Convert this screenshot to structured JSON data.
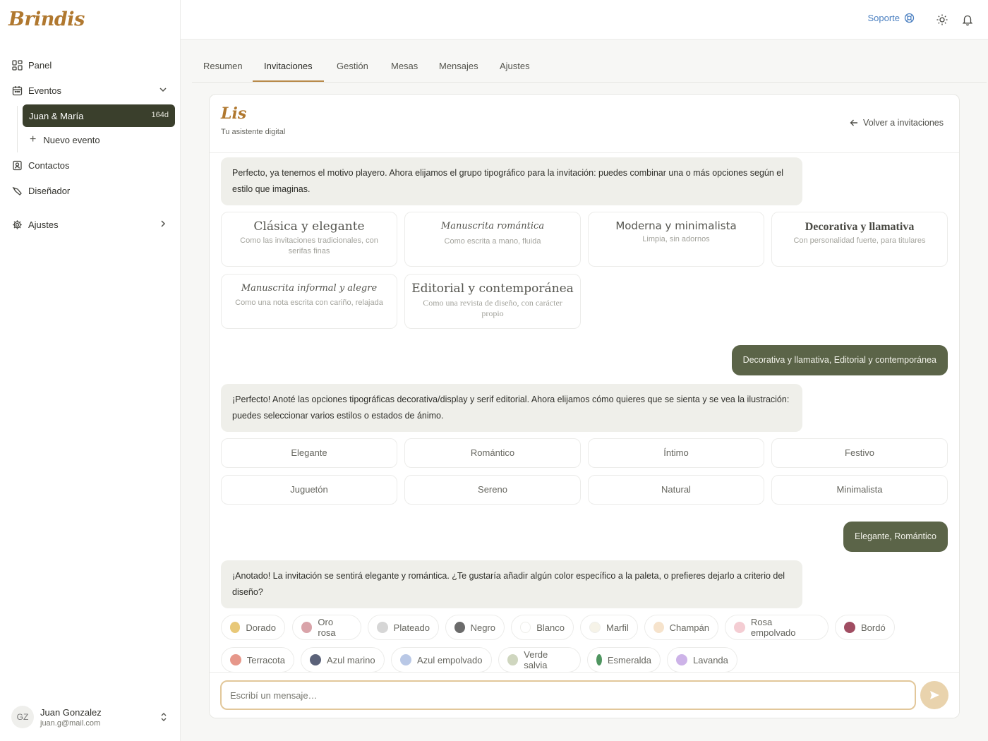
{
  "brand": "Brindis",
  "sidebar": {
    "panel": "Panel",
    "eventos": "Eventos",
    "active_event": {
      "label": "Juan & María",
      "badge": "164d"
    },
    "new_event": "Nuevo evento",
    "contactos": "Contactos",
    "disenador": "Diseñador",
    "ajustes": "Ajustes"
  },
  "user": {
    "initials": "GZ",
    "name": "Juan Gonzalez",
    "email": "juan.g@mail.com"
  },
  "header": {
    "support": "Soporte"
  },
  "tabs": [
    "Resumen",
    "Invitaciones",
    "Gestión",
    "Mesas",
    "Mensajes",
    "Ajustes"
  ],
  "active_tab": "Invitaciones",
  "assistant": {
    "name": "Lis",
    "subtitle": "Tu asistente digital",
    "back": "Volver a invitaciones"
  },
  "messages": {
    "bot1": "Perfecto, ya tenemos el motivo playero. Ahora elijamos el grupo tipográfico para la invitación: puedes combinar una o más opciones según el estilo que imaginas.",
    "user1": "Decorativa y llamativa, Editorial y contemporánea",
    "bot2": "¡Perfecto! Anoté las opciones tipográficas decorativa/display y serif editorial. Ahora elijamos cómo quieres que se sienta y se vea la ilustración: puedes seleccionar varios estilos o estados de ánimo.",
    "user2": "Elegante, Romántico",
    "bot3": "¡Anotado! La invitación se sentirá elegante y romántica. ¿Te gustaría añadir algún color específico a la paleta, o prefieres dejarlo a criterio del diseño?"
  },
  "font_options": [
    {
      "title": "Clásica y elegante",
      "desc": "Como las invitaciones tradicionales, con serifas finas"
    },
    {
      "title": "Manuscrita romántica",
      "desc": "Como escrita a mano, fluida"
    },
    {
      "title": "Moderna y minimalista",
      "desc": "Limpia, sin adornos"
    },
    {
      "title": "Decorativa y llamativa",
      "desc": "Con personalidad fuerte, para titulares"
    },
    {
      "title": "Manuscrita informal y alegre",
      "desc": "Como una nota escrita con cariño, relajada"
    },
    {
      "title": "Editorial y contemporánea",
      "desc": "Como una revista de diseño, con carácter propio"
    }
  ],
  "moods": [
    "Elegante",
    "Romántico",
    "Íntimo",
    "Festivo",
    "Juguetón",
    "Sereno",
    "Natural",
    "Minimalista"
  ],
  "colors": [
    {
      "name": "Dorado",
      "hex": "#e8c878"
    },
    {
      "name": "Oro rosa",
      "hex": "#d9a3a9"
    },
    {
      "name": "Plateado",
      "hex": "#d6d6d6"
    },
    {
      "name": "Negro",
      "hex": "#6b6b6b"
    },
    {
      "name": "Blanco",
      "hex": "#ffffff"
    },
    {
      "name": "Marfil",
      "hex": "#f6f3e8"
    },
    {
      "name": "Champán",
      "hex": "#f6e3cc"
    },
    {
      "name": "Rosa empolvado",
      "hex": "#f4cdd3"
    },
    {
      "name": "Bordó",
      "hex": "#a04d62"
    },
    {
      "name": "Terracota",
      "hex": "#e6978a"
    },
    {
      "name": "Azul marino",
      "hex": "#5b6279"
    },
    {
      "name": "Azul empolvado",
      "hex": "#b9c8e6"
    },
    {
      "name": "Verde salvia",
      "hex": "#cfd6bf"
    },
    {
      "name": "Esmeralda",
      "hex": "#4f9560"
    },
    {
      "name": "Lavanda",
      "hex": "#cdb3e8"
    }
  ],
  "composer": {
    "placeholder": "Escribí un mensaje…"
  }
}
